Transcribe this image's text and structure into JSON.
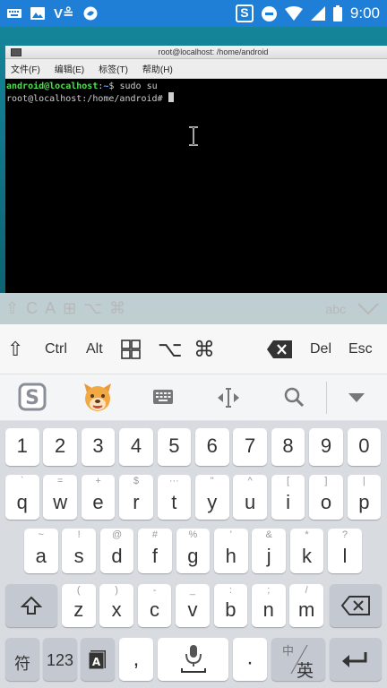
{
  "statusbar": {
    "time": "9:00",
    "notification_icons": [
      "keyboard-icon",
      "image-icon",
      "vnc-icon",
      "shield-app-icon"
    ],
    "status_icons": [
      "sogou-s-icon",
      "do-not-disturb-icon",
      "wifi-icon",
      "cellular-signal-icon",
      "battery-icon"
    ]
  },
  "terminal": {
    "window_title": "root@localhost: /home/android",
    "menu": [
      "文件(F)",
      "编辑(E)",
      "标签(T)",
      "帮助(H)"
    ],
    "line1_user": "android@localhost",
    "line1_sep": ":",
    "line1_path": "~",
    "line1_cmd": "$ sudo su",
    "line2_prompt": "root@localhost:/home/android# "
  },
  "overlay_keys": {
    "keys": [
      "⇧",
      "C",
      "A",
      "⊞",
      "⌥",
      "⌘"
    ],
    "abc": "abc"
  },
  "modifier_row": {
    "shift": "⇧",
    "ctrl": "Ctrl",
    "alt": "Alt",
    "option": "⌥",
    "command": "⌘",
    "del": "Del",
    "esc": "Esc"
  },
  "keyboard": {
    "number_row": [
      "1",
      "2",
      "3",
      "4",
      "5",
      "6",
      "7",
      "8",
      "9",
      "0"
    ],
    "row1": [
      {
        "main": "q",
        "hint": "`"
      },
      {
        "main": "w",
        "hint": "="
      },
      {
        "main": "e",
        "hint": "+"
      },
      {
        "main": "r",
        "hint": "$"
      },
      {
        "main": "t",
        "hint": "···"
      },
      {
        "main": "y",
        "hint": "\""
      },
      {
        "main": "u",
        "hint": "^"
      },
      {
        "main": "i",
        "hint": "["
      },
      {
        "main": "o",
        "hint": "]"
      },
      {
        "main": "p",
        "hint": "|"
      }
    ],
    "row2": [
      {
        "main": "a",
        "hint": "~"
      },
      {
        "main": "s",
        "hint": "!"
      },
      {
        "main": "d",
        "hint": "@"
      },
      {
        "main": "f",
        "hint": "#"
      },
      {
        "main": "g",
        "hint": "%"
      },
      {
        "main": "h",
        "hint": "'"
      },
      {
        "main": "j",
        "hint": "&"
      },
      {
        "main": "k",
        "hint": "*"
      },
      {
        "main": "l",
        "hint": "?"
      }
    ],
    "row3": [
      {
        "main": "z",
        "hint": "("
      },
      {
        "main": "x",
        "hint": ")"
      },
      {
        "main": "c",
        "hint": "-"
      },
      {
        "main": "v",
        "hint": "_"
      },
      {
        "main": "b",
        "hint": ":"
      },
      {
        "main": "n",
        "hint": ";"
      },
      {
        "main": "m",
        "hint": "/"
      }
    ],
    "symbol_key": "符",
    "numeric_key": "123",
    "comma_key": ",",
    "period_key": "·",
    "lang_switch_top": "中",
    "lang_switch_bottom": "英"
  }
}
